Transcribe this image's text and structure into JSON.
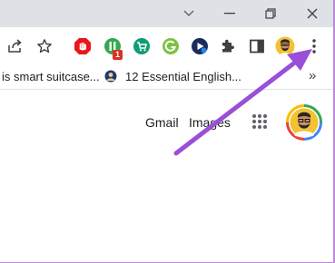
{
  "window": {
    "controls": [
      "minimize",
      "restore",
      "close"
    ]
  },
  "toolbar": {
    "icons": [
      "share-icon",
      "bookmark-star-icon",
      "adblock-extension-icon",
      "extension-green-icon",
      "extension-cart-icon",
      "extension-grammarly-icon",
      "extension-play-icon",
      "extensions-puzzle-icon",
      "side-panel-icon",
      "profile-avatar",
      "menu-kebab-icon"
    ],
    "badge_count": "1"
  },
  "bookmarks": {
    "item1": "is smart suitcase...",
    "item2": "12 Essential English...",
    "overflow": "»"
  },
  "google": {
    "gmail": "Gmail",
    "images": "Images"
  },
  "colors": {
    "arrow": "#9a4fd8",
    "frame_border": "#b98ad6"
  }
}
